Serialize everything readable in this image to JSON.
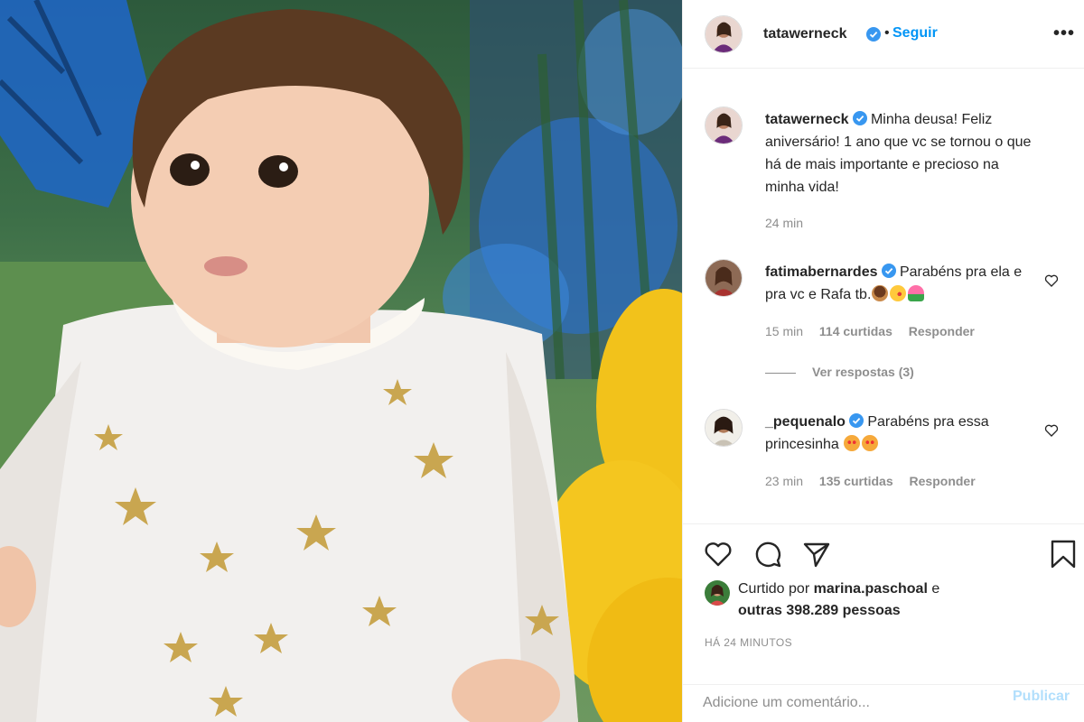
{
  "post": {
    "image_alt": "Foto de um bebê com vestido de tule branco com estrelas douradas"
  },
  "header": {
    "username": "tatawerneck",
    "separator": "•",
    "follow_label": "Seguir",
    "more_label": "•••",
    "verified_icon": "verified-badge-icon"
  },
  "caption": {
    "username": "tatawerneck",
    "text": "Minha deusa! Feliz aniversário! 1 ano que vc se tornou o que há de mais importante e precioso na minha vida!",
    "time": "24 min"
  },
  "comments": [
    {
      "username": "fatimabernardes",
      "text": "Parabéns pra ela e pra vc e Rafa tb.",
      "emojis": [
        "cake-emoji",
        "kiss-emoji",
        "tulip-emoji"
      ],
      "time": "15 min",
      "likes": "114 curtidas",
      "reply_label": "Responder",
      "view_replies": "Ver respostas (3)"
    },
    {
      "username": "_pequenalo",
      "text": "Parabéns pra essa princesinha",
      "emojis": [
        "heart-eyes-cat-emoji",
        "heart-eyes-cat-emoji"
      ],
      "time": "23 min",
      "likes": "135 curtidas",
      "reply_label": "Responder"
    }
  ],
  "actions": {
    "icons": [
      "heart-icon",
      "comment-icon",
      "share-icon",
      "bookmark-icon"
    ],
    "liked_prefix": "Curtido por",
    "liked_user": "marina.paschoal",
    "liked_and": "e",
    "liked_others": "outras 398.289 pessoas",
    "timestamp": "HÁ 24 MINUTOS"
  },
  "add_comment": {
    "placeholder": "Adicione um comentário...",
    "post_label": "Publicar"
  },
  "colors": {
    "accent": "#0095f6",
    "verified": "#3897f0",
    "muted": "#8e8e8e",
    "text": "#262626",
    "post_disabled": "#b2dffc"
  }
}
